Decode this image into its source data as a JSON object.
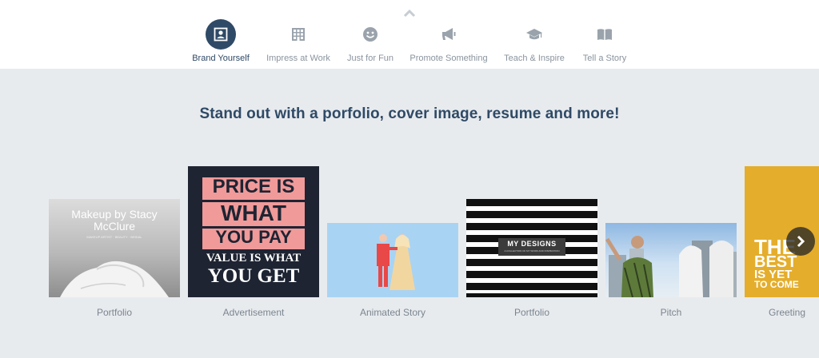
{
  "nav": {
    "items": [
      {
        "label": "Brand Yourself",
        "icon": "id-badge-icon",
        "active": true
      },
      {
        "label": "Impress at Work",
        "icon": "building-icon",
        "active": false
      },
      {
        "label": "Just for Fun",
        "icon": "smiley-icon",
        "active": false
      },
      {
        "label": "Promote Something",
        "icon": "megaphone-icon",
        "active": false
      },
      {
        "label": "Teach & Inspire",
        "icon": "graduation-cap-icon",
        "active": false
      },
      {
        "label": "Tell a Story",
        "icon": "open-book-icon",
        "active": false
      }
    ]
  },
  "headline": "Stand out with a porfolio, cover image, resume and more!",
  "cards": [
    {
      "label": "Portfolio",
      "thumb_title_line1": "Makeup by Stacy",
      "thumb_title_line2": "McClure",
      "thumb_subtitle": "MAKEUP ARTIST · BEAUTY · BRIDAL"
    },
    {
      "label": "Advertisement",
      "thumb_lines": [
        "PRICE IS",
        "WHAT",
        "YOU PAY",
        "VALUE IS WHAT",
        "YOU GET"
      ]
    },
    {
      "label": "Animated Story"
    },
    {
      "label": "Portfolio",
      "thumb_title": "MY DESIGNS",
      "thumb_subtitle": "A COLLECTION OF MY WORK AND INSPIRATION"
    },
    {
      "label": "Pitch"
    },
    {
      "label": "Greeting",
      "thumb_lines": [
        "THE",
        "BEST",
        "IS YET",
        "TO COME"
      ]
    }
  ],
  "colors": {
    "accent": "#2f4a66",
    "background": "#e8ebee",
    "muted_text": "#8a949e",
    "header_bg": "#ffffff"
  }
}
